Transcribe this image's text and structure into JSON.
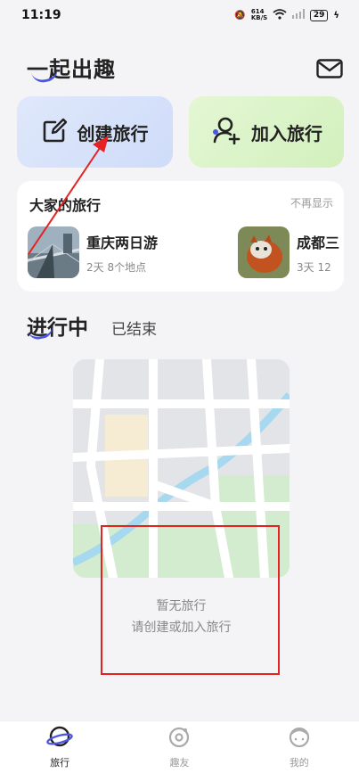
{
  "status_bar": {
    "time": "11:19",
    "network_speed": "614 KB/S",
    "battery": "29"
  },
  "header": {
    "title": "一起出趣",
    "mail_icon": "mail-icon"
  },
  "actions": {
    "create_label": "创建旅行",
    "join_label": "加入旅行"
  },
  "everyone_trips": {
    "heading": "大家的旅行",
    "hide_label": "不再显示",
    "items": [
      {
        "name": "重庆两日游",
        "meta": "2天  8个地点"
      },
      {
        "name": "成都三",
        "meta": "3天  12"
      }
    ]
  },
  "trip_tabs": {
    "active": "进行中",
    "inactive": "已结束"
  },
  "empty_state": {
    "line1": "暂无旅行",
    "line2": "请创建或加入旅行"
  },
  "bottom_nav": [
    {
      "label": "旅行",
      "icon": "planet-icon",
      "active": true
    },
    {
      "label": "趣友",
      "icon": "friends-icon",
      "active": false
    },
    {
      "label": "我的",
      "icon": "profile-icon",
      "active": false
    }
  ],
  "colors": {
    "accent": "#4c56e0",
    "annotation_red": "#e52222"
  }
}
